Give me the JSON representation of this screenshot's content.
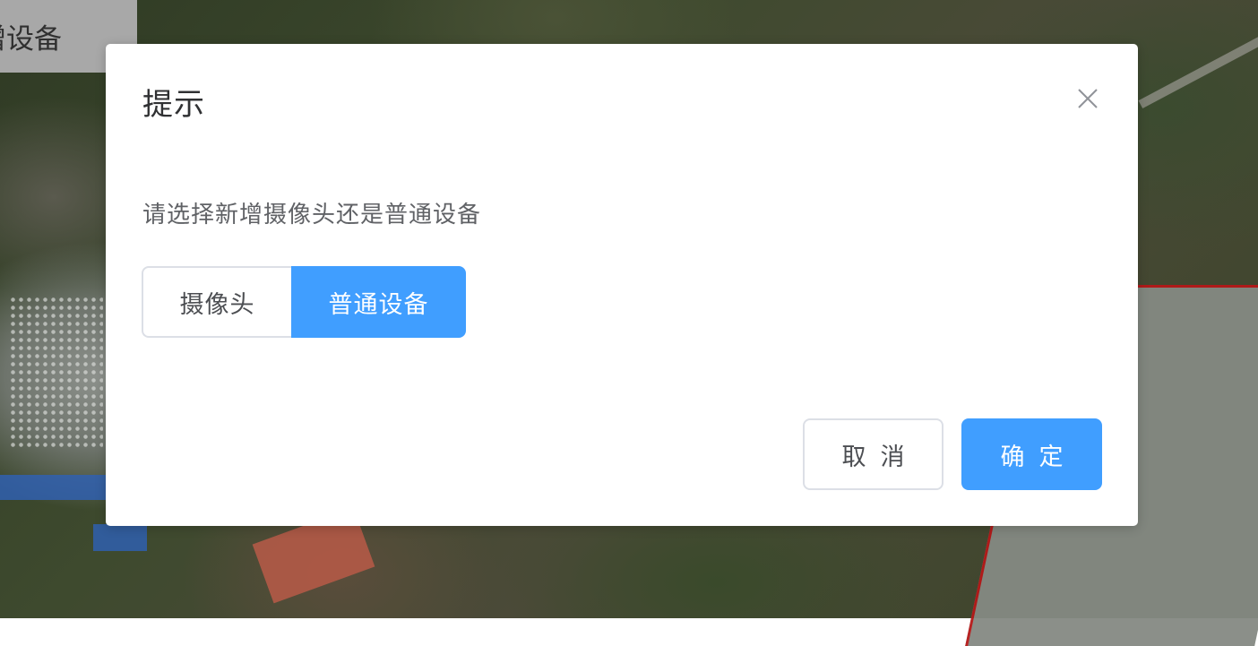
{
  "background": {
    "tab_label": "增设备"
  },
  "dialog": {
    "title": "提示",
    "close_icon": "close-icon",
    "message": "请选择新增摄像头还是普通设备",
    "options": [
      {
        "label": "摄像头",
        "selected": false
      },
      {
        "label": "普通设备",
        "selected": true
      }
    ],
    "cancel_label": "取消",
    "confirm_label": "确定"
  },
  "colors": {
    "primary": "#409eff",
    "border": "#dcdfe6",
    "title_text": "#303133",
    "body_text": "#606266"
  }
}
